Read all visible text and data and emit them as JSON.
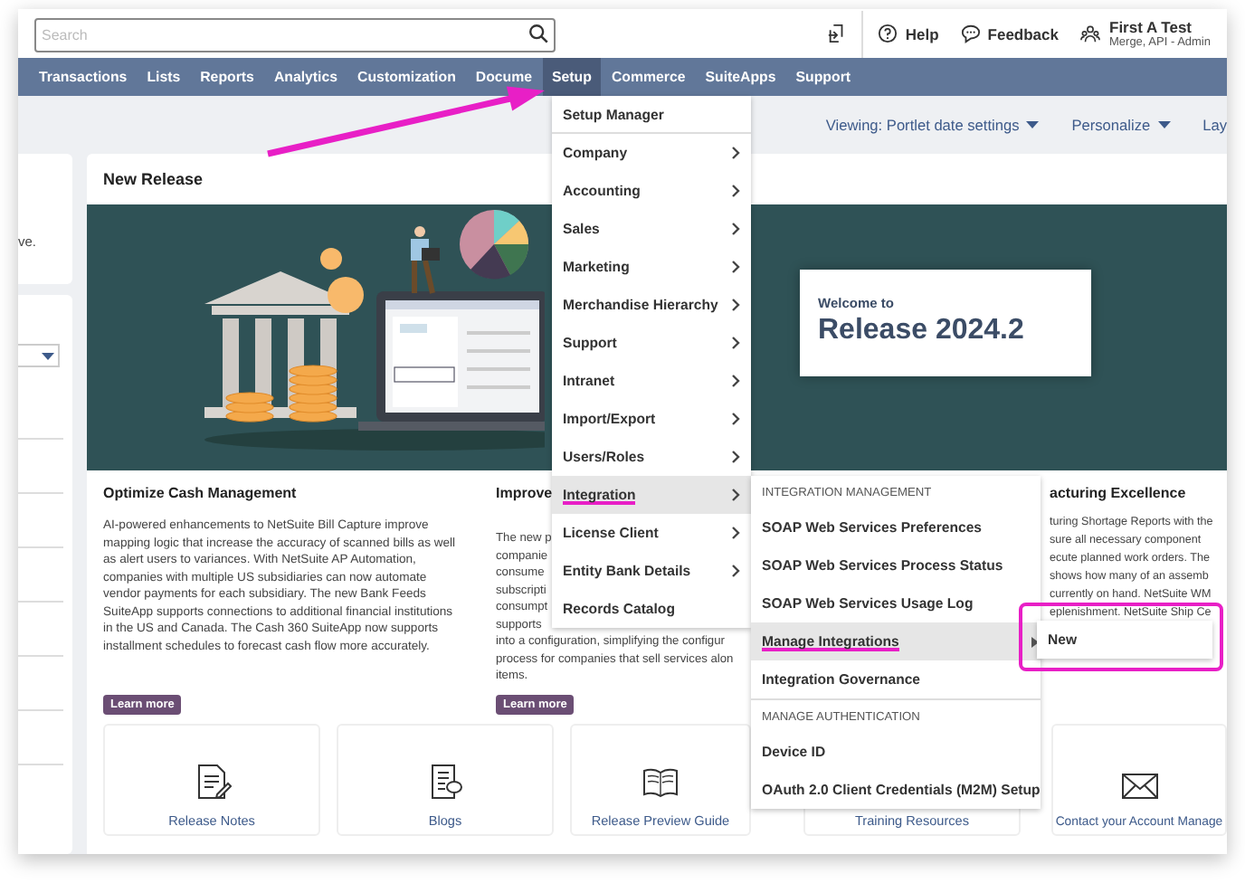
{
  "search": {
    "placeholder": "Search"
  },
  "header": {
    "help": "Help",
    "feedback": "Feedback",
    "user_name": "First A Test",
    "user_role": "Merge, API - Admin"
  },
  "nav": [
    {
      "label": "Transactions",
      "selected": false
    },
    {
      "label": "Lists",
      "selected": false
    },
    {
      "label": "Reports",
      "selected": false
    },
    {
      "label": "Analytics",
      "selected": false
    },
    {
      "label": "Customization",
      "selected": false
    },
    {
      "label": "Docume",
      "selected": false
    },
    {
      "label": "Setup",
      "selected": true
    },
    {
      "label": "Commerce",
      "selected": false
    },
    {
      "label": "SuiteApps",
      "selected": false
    },
    {
      "label": "Support",
      "selected": false
    }
  ],
  "toolbar": [
    {
      "label": "Viewing: Portlet date settings",
      "dropdown": true
    },
    {
      "label": "Personalize",
      "dropdown": true
    },
    {
      "label": "Lay",
      "dropdown": false
    }
  ],
  "left_panel": {
    "text": "ve."
  },
  "portlet": {
    "title": "New Release",
    "banner": {
      "welcome": "Welcome to",
      "release": "Release 2024.2"
    },
    "articles": [
      {
        "kind": "paragraph",
        "heading": "Optimize Cash Management",
        "text": "AI-powered enhancements to NetSuite Bill Capture improve mapping logic that increase the accuracy of scanned bills as well as alert users to variances. With NetSuite AP Automation, companies with multiple US subsidiaries can now automate vendor payments for each subsidiary. The new Bank Feeds SuiteApp supports connections to additional financial institutions in the US and Canada. The Cash 360 SuiteApp now supports installment schedules to forecast cash flow more accurately.",
        "button": "Learn more"
      },
      {
        "kind": "fragments",
        "heading": "Improve",
        "lines": [
          "The new p",
          "companie",
          "consume",
          "subscripti",
          "consumpt",
          "supports",
          "into a configuration, simplifying the configur",
          "process for companies that sell services alon",
          "items."
        ],
        "button": "Learn more"
      },
      {
        "kind": "fragments",
        "heading": "acturing Excellence",
        "lines": [
          "turing Shortage Reports with the",
          "sure all necessary component",
          "ecute planned work orders. The",
          "shows how many of an assemb",
          "currently on hand. NetSuite WM",
          "eplenishment. NetSuite Ship Ce"
        ]
      }
    ],
    "tiles": [
      {
        "kind": "notes",
        "label": "Release Notes"
      },
      {
        "kind": "blog",
        "label": "Blogs"
      },
      {
        "kind": "book",
        "label": "Release Preview Guide"
      },
      {
        "kind": "training",
        "label": "Training Resources"
      },
      {
        "kind": "mail",
        "label": "Contact your Account Manage"
      }
    ]
  },
  "setup_menu": {
    "items": [
      {
        "label": "Setup Manager",
        "submenu": false,
        "selected": false,
        "underlined": false
      },
      {
        "label": "Company",
        "submenu": true,
        "selected": false,
        "underlined": false
      },
      {
        "label": "Accounting",
        "submenu": true,
        "selected": false,
        "underlined": false
      },
      {
        "label": "Sales",
        "submenu": true,
        "selected": false,
        "underlined": false
      },
      {
        "label": "Marketing",
        "submenu": true,
        "selected": false,
        "underlined": false
      },
      {
        "label": "Merchandise Hierarchy",
        "submenu": true,
        "selected": false,
        "underlined": false
      },
      {
        "label": "Support",
        "submenu": true,
        "selected": false,
        "underlined": false
      },
      {
        "label": "Intranet",
        "submenu": true,
        "selected": false,
        "underlined": false
      },
      {
        "label": "Import/Export",
        "submenu": true,
        "selected": false,
        "underlined": false
      },
      {
        "label": "Users/Roles",
        "submenu": true,
        "selected": false,
        "underlined": false
      },
      {
        "label": "Integration",
        "submenu": true,
        "selected": true,
        "underlined": true
      },
      {
        "label": "License Client",
        "submenu": true,
        "selected": false,
        "underlined": false
      },
      {
        "label": "Entity Bank Details",
        "submenu": true,
        "selected": false,
        "underlined": false
      },
      {
        "label": "Records Catalog",
        "submenu": false,
        "selected": false,
        "underlined": false
      }
    ]
  },
  "integration_menu": {
    "sections": [
      {
        "heading": "INTEGRATION MANAGEMENT",
        "items": [
          {
            "label": "SOAP Web Services Preferences",
            "submenu": false,
            "selected": false,
            "underlined": false
          },
          {
            "label": "SOAP Web Services Process Status",
            "submenu": false,
            "selected": false,
            "underlined": false
          },
          {
            "label": "SOAP Web Services Usage Log",
            "submenu": false,
            "selected": false,
            "underlined": false
          },
          {
            "label": "Manage Integrations",
            "submenu": true,
            "selected": true,
            "underlined": true
          },
          {
            "label": "Integration Governance",
            "submenu": false,
            "selected": false,
            "underlined": false
          }
        ]
      },
      {
        "heading": "MANAGE AUTHENTICATION",
        "items": [
          {
            "label": "Device ID",
            "submenu": false,
            "selected": false,
            "underlined": false
          },
          {
            "label": "OAuth 2.0 Client Credentials (M2M) Setup",
            "submenu": false,
            "selected": false,
            "underlined": false
          }
        ]
      }
    ]
  },
  "new_menu": {
    "items": [
      "New"
    ],
    "outlined": true
  },
  "annotation": {
    "arrow": true
  }
}
